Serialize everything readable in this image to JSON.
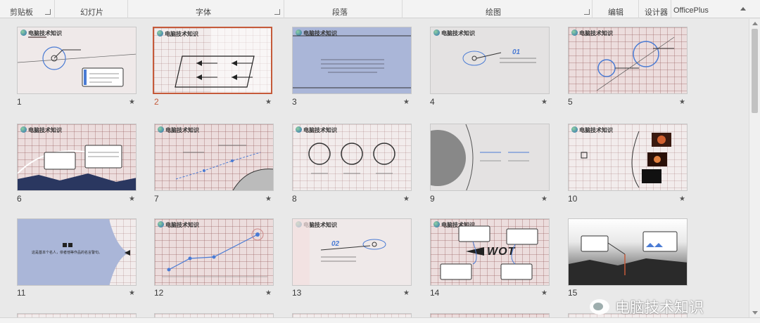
{
  "ribbon": {
    "groups": [
      {
        "label": "剪贴板",
        "launcher": true
      },
      {
        "label": "幻灯片",
        "launcher": false
      },
      {
        "label": "字体",
        "launcher": true
      },
      {
        "label": "段落",
        "launcher": false
      },
      {
        "label": "绘图",
        "launcher": true
      },
      {
        "label": "编辑",
        "launcher": false
      },
      {
        "label": "设计器",
        "launcher": false
      },
      {
        "label": "OfficePlus",
        "launcher": false
      }
    ]
  },
  "slide_title": "电脑技术知识",
  "selected_slide": "2",
  "slides": [
    {
      "num": "1",
      "bg": "plain"
    },
    {
      "num": "2",
      "bg": "grid"
    },
    {
      "num": "3",
      "bg": "blue"
    },
    {
      "num": "4",
      "bg": "gray",
      "label": "01"
    },
    {
      "num": "5",
      "bg": "grid"
    },
    {
      "num": "6",
      "bg": "grid"
    },
    {
      "num": "7",
      "bg": "grid"
    },
    {
      "num": "8",
      "bg": "grid"
    },
    {
      "num": "9",
      "bg": "gray"
    },
    {
      "num": "10",
      "bg": "grid"
    },
    {
      "num": "11",
      "bg": "blue",
      "label": "这是基本个名人，依者他等作品的名言警句。"
    },
    {
      "num": "12",
      "bg": "grid"
    },
    {
      "num": "13",
      "bg": "plain",
      "label": "02"
    },
    {
      "num": "14",
      "bg": "grid",
      "label": "WOT"
    },
    {
      "num": "15",
      "bg": "dark"
    }
  ],
  "watermark": "电脑技术知识",
  "colors": {
    "accent": "#c55a3a",
    "highlight": "#4a7bd4"
  }
}
